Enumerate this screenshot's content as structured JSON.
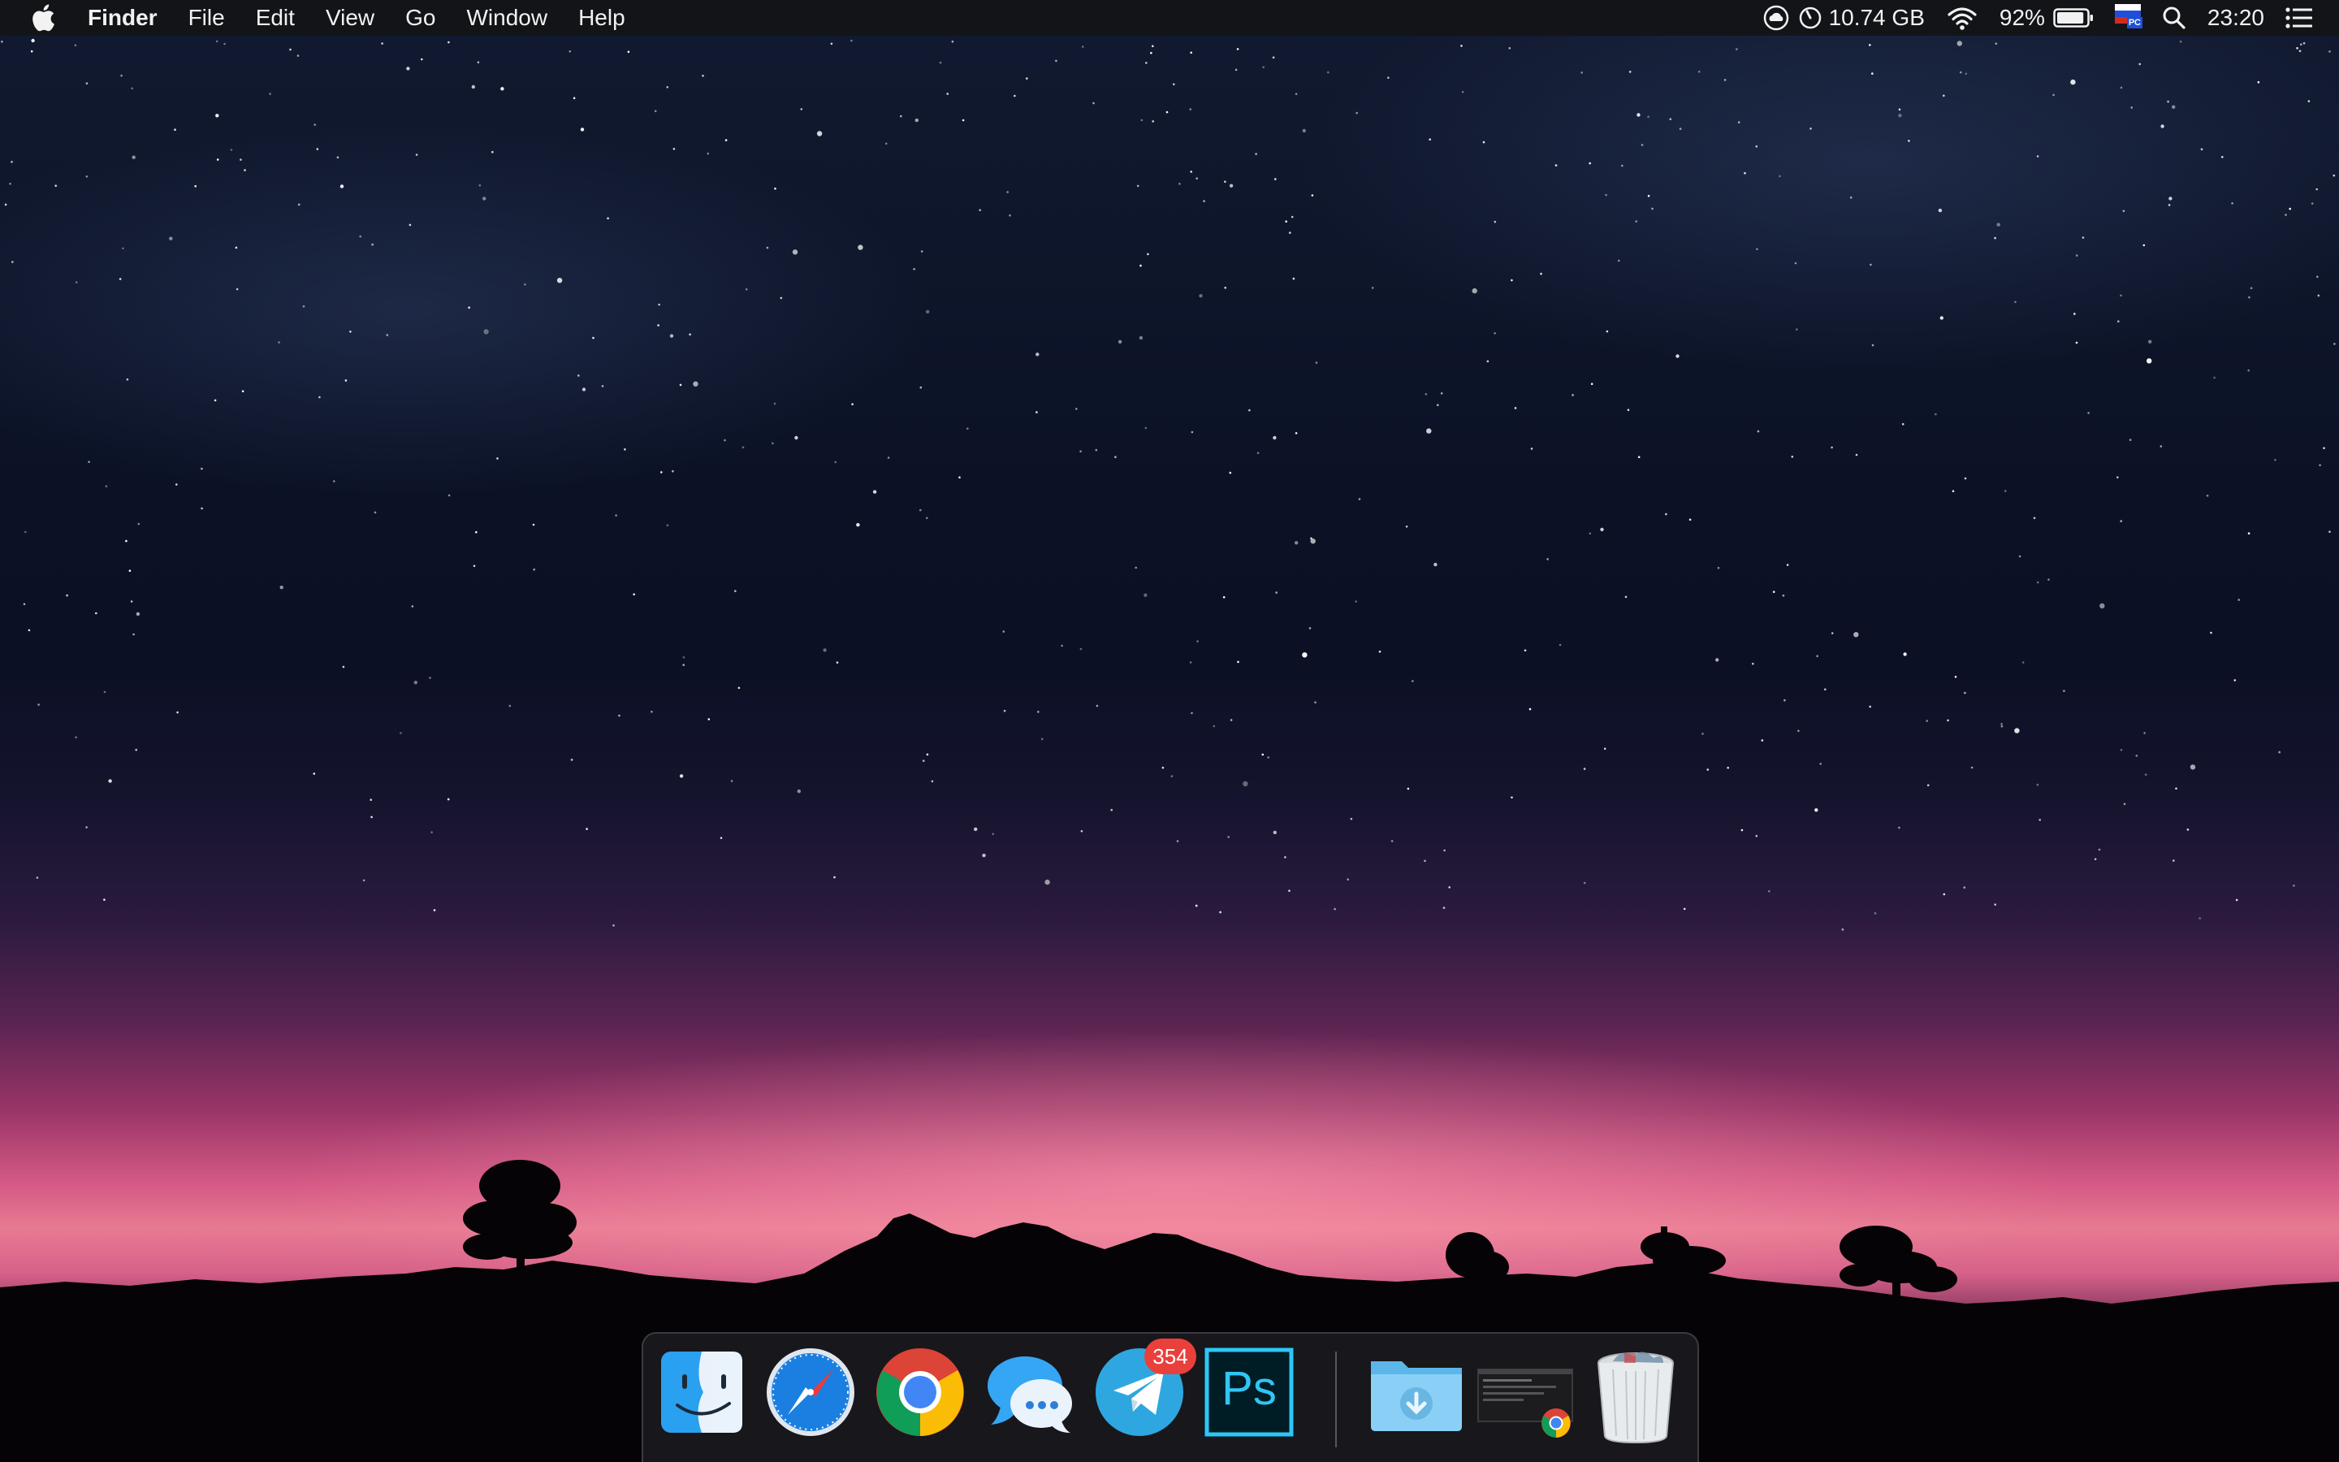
{
  "menubar": {
    "app_name": "Finder",
    "menus": [
      "File",
      "Edit",
      "View",
      "Go",
      "Window",
      "Help"
    ],
    "status": {
      "storage_free": "10.74 GB",
      "battery_percent": "92%",
      "battery_level": 0.92,
      "input_flag": "РС",
      "clock": "23:20"
    }
  },
  "dock": {
    "apps": [
      {
        "name": "Finder",
        "running": true
      },
      {
        "name": "Safari",
        "running": false
      },
      {
        "name": "Google Chrome",
        "running": true
      },
      {
        "name": "Messages",
        "running": false
      },
      {
        "name": "Telegram",
        "running": true,
        "badge": "354"
      },
      {
        "name": "Photoshop",
        "running": false,
        "label": "Ps"
      }
    ],
    "stacks": [
      {
        "name": "Downloads"
      },
      {
        "name": "Chrome Screenshot"
      },
      {
        "name": "Trash"
      }
    ]
  },
  "colors": {
    "badge": "#e9403c",
    "photoshop_accent": "#31c5f4",
    "menubar": "#141416"
  }
}
